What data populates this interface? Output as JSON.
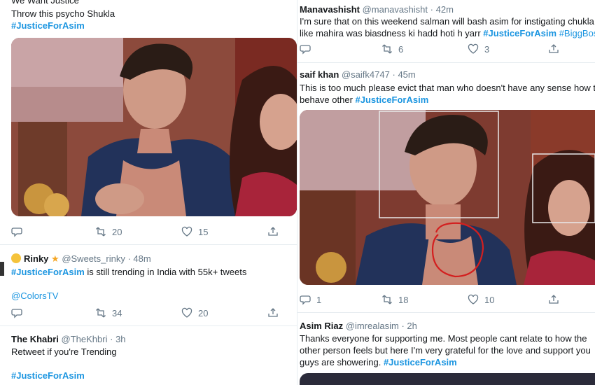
{
  "left": {
    "top_tweet": {
      "line1": "We Want Justice",
      "line2": "Throw this psycho Shukla",
      "hashtag": "#JusticeForAsim",
      "retweets": "20",
      "likes": "15"
    },
    "rinky": {
      "name": "Rinky",
      "handle": "@Sweets_rinky",
      "time": "48m",
      "hashtag": "#JusticeForAsim",
      "text": " is still trending in India with 55k+ tweets",
      "mention": "@ColorsTV",
      "retweets": "34",
      "likes": "20"
    },
    "khabri": {
      "name": "The Khabri",
      "handle": "@TheKhbri",
      "time": "3h",
      "text": "Retweet if you're Trending",
      "hashtag": "#JusticeForAsim"
    }
  },
  "right": {
    "manavashisht": {
      "name": "Manavashisht",
      "handle": "@manavashisht",
      "time": "42m",
      "line1": "I'm sure that on this weekend salman will bash asim for instigating chukla",
      "line2_text": "like mahira was biasdness ki hadd hoti h yarr ",
      "hashtag1": "#JusticeForAsim",
      "hashtag2": "#BiggBoss",
      "retweets": "6",
      "likes": "3"
    },
    "saif": {
      "name": "saif khan",
      "handle": "@saifk4747",
      "time": "45m",
      "line1": "This is too much please evict that man who doesn't have any sense how to",
      "line2_text": "behave other ",
      "hashtag": "#JusticeForAsim",
      "replies": "1",
      "retweets": "18",
      "likes": "10"
    },
    "asim": {
      "name": "Asim Riaz",
      "handle": "@imrealasim",
      "time": "2h",
      "line1": "Thanks everyone for supporting me. Most people cant relate to how the",
      "line2": "other person feels but here I'm very grateful for the love and support you",
      "line3_text": "guys are showering.  ",
      "hashtag": "#JusticeForAsim"
    }
  },
  "separator": "·",
  "colors": {
    "accent": "#1b95e0",
    "muted": "#657786",
    "border": "#e6ecf0"
  }
}
